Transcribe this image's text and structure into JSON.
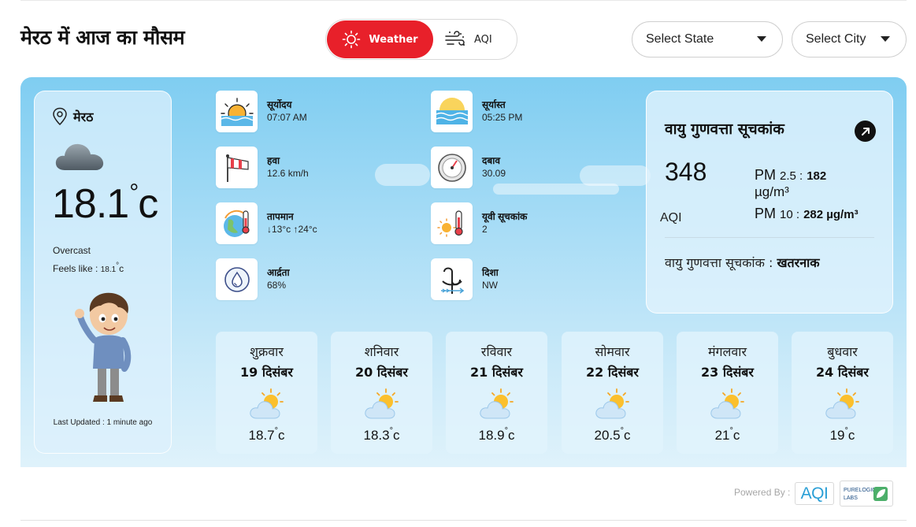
{
  "header": {
    "title": "मेरठ में आज का मौसम"
  },
  "toggle": {
    "weather_label": "Weather",
    "aqi_label": "AQI"
  },
  "selects": {
    "state_label": "Select State",
    "city_label": "Select City"
  },
  "current": {
    "city": "मेरठ",
    "temp": "18.1",
    "temp_unit": "c",
    "condition": "Overcast",
    "feels_label": "Feels like :",
    "feels_value": "18.1",
    "feels_unit": "c",
    "last_updated": "Last Updated : 1 minute ago"
  },
  "stats": {
    "sunrise": {
      "label": "सूर्योदय",
      "value": "07:07 AM",
      "icon": "sunrise-icon"
    },
    "sunset": {
      "label": "सूर्यास्त",
      "value": "05:25 PM",
      "icon": "sunset-icon"
    },
    "wind": {
      "label": "हवा",
      "value": "12.6 km/h",
      "icon": "windsock-icon"
    },
    "pressure": {
      "label": "दबाव",
      "value": "30.09",
      "icon": "barometer-icon"
    },
    "temperature": {
      "label": "तापमान",
      "value": "↓13°c ↑24°c",
      "icon": "thermometer-globe-icon"
    },
    "uv": {
      "label": "यूवी सूचकांक",
      "value": "2",
      "icon": "uv-index-icon"
    },
    "humidity": {
      "label": "आर्द्रता",
      "value": "68%",
      "icon": "humidity-icon"
    },
    "direction": {
      "label": "दिशा",
      "value": "NW",
      "icon": "wind-vane-icon"
    }
  },
  "aqi": {
    "title": "वायु गुणवत्ता सूचकांक",
    "value": "348",
    "unit_label": "AQI",
    "pm25_label": "PM",
    "pm25_sub": "2.5 :",
    "pm25_value": "182",
    "pm25_unit": "µg/m³",
    "pm10_label": "PM",
    "pm10_sub": "10 :",
    "pm10_value": "282 µg/m³",
    "status_label": "वायु गुणवत्ता सूचकांक :",
    "status_value": "खतरनाक"
  },
  "forecast": [
    {
      "day": "शुक्रवार",
      "date": "19 दिसंबर",
      "temp": "18.7",
      "unit": "c",
      "icon": "partly-sunny-icon"
    },
    {
      "day": "शनिवार",
      "date": "20 दिसंबर",
      "temp": "18.3",
      "unit": "c",
      "icon": "partly-sunny-icon"
    },
    {
      "day": "रविवार",
      "date": "21 दिसंबर",
      "temp": "18.9",
      "unit": "c",
      "icon": "partly-sunny-icon"
    },
    {
      "day": "सोमवार",
      "date": "22 दिसंबर",
      "temp": "20.5",
      "unit": "c",
      "icon": "partly-sunny-icon"
    },
    {
      "day": "मंगलवार",
      "date": "23 दिसंबर",
      "temp": "21",
      "unit": "c",
      "icon": "partly-sunny-icon"
    },
    {
      "day": "बुधवार",
      "date": "24 दिसंबर",
      "temp": "19",
      "unit": "c",
      "icon": "partly-sunny-icon"
    }
  ],
  "footer": {
    "powered_by": "Powered By :",
    "logo_aqi_text": "AQI",
    "logo_purelogic_text": "PURELOGIC LABS"
  },
  "colors": {
    "accent": "#e8202a",
    "sky_top": "#7fcdf1",
    "sky_bottom": "#dff2fb",
    "aqi_logo": "#2a9fd6"
  }
}
